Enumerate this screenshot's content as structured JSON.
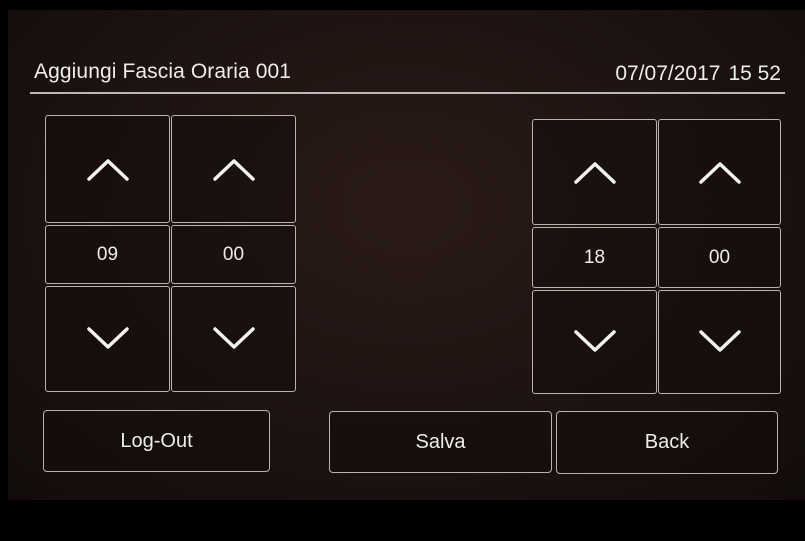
{
  "header": {
    "title": "Aggiungi Fascia Oraria 001",
    "date": "07/07/2017",
    "time": "15 52"
  },
  "start_time": {
    "hour": "09",
    "minute": "00"
  },
  "end_time": {
    "hour": "18",
    "minute": "00"
  },
  "buttons": {
    "logout": "Log-Out",
    "save": "Salva",
    "back": "Back"
  },
  "icons": {
    "increment": "chevron-up-icon",
    "decrement": "chevron-down-icon"
  },
  "colors": {
    "background": "#1d1311",
    "foreground": "#ececec",
    "border": "#b9b2af"
  }
}
